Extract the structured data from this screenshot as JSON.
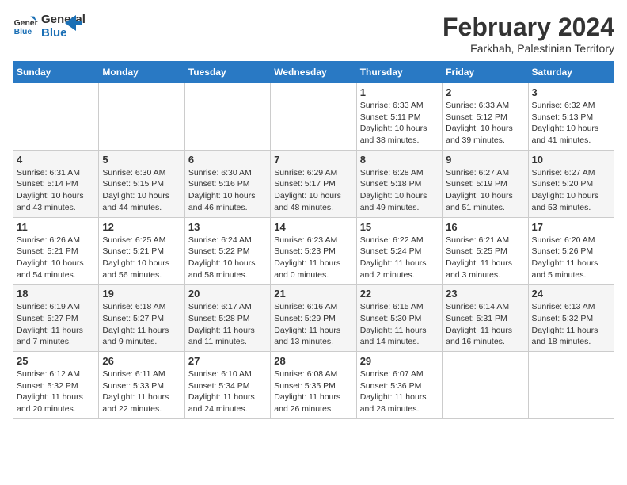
{
  "logo": {
    "line1": "General",
    "line2": "Blue"
  },
  "title": "February 2024",
  "location": "Farkhah, Palestinian Territory",
  "days_of_week": [
    "Sunday",
    "Monday",
    "Tuesday",
    "Wednesday",
    "Thursday",
    "Friday",
    "Saturday"
  ],
  "weeks": [
    [
      {
        "day": "",
        "info": ""
      },
      {
        "day": "",
        "info": ""
      },
      {
        "day": "",
        "info": ""
      },
      {
        "day": "",
        "info": ""
      },
      {
        "day": "1",
        "info": "Sunrise: 6:33 AM\nSunset: 5:11 PM\nDaylight: 10 hours\nand 38 minutes."
      },
      {
        "day": "2",
        "info": "Sunrise: 6:33 AM\nSunset: 5:12 PM\nDaylight: 10 hours\nand 39 minutes."
      },
      {
        "day": "3",
        "info": "Sunrise: 6:32 AM\nSunset: 5:13 PM\nDaylight: 10 hours\nand 41 minutes."
      }
    ],
    [
      {
        "day": "4",
        "info": "Sunrise: 6:31 AM\nSunset: 5:14 PM\nDaylight: 10 hours\nand 43 minutes."
      },
      {
        "day": "5",
        "info": "Sunrise: 6:30 AM\nSunset: 5:15 PM\nDaylight: 10 hours\nand 44 minutes."
      },
      {
        "day": "6",
        "info": "Sunrise: 6:30 AM\nSunset: 5:16 PM\nDaylight: 10 hours\nand 46 minutes."
      },
      {
        "day": "7",
        "info": "Sunrise: 6:29 AM\nSunset: 5:17 PM\nDaylight: 10 hours\nand 48 minutes."
      },
      {
        "day": "8",
        "info": "Sunrise: 6:28 AM\nSunset: 5:18 PM\nDaylight: 10 hours\nand 49 minutes."
      },
      {
        "day": "9",
        "info": "Sunrise: 6:27 AM\nSunset: 5:19 PM\nDaylight: 10 hours\nand 51 minutes."
      },
      {
        "day": "10",
        "info": "Sunrise: 6:27 AM\nSunset: 5:20 PM\nDaylight: 10 hours\nand 53 minutes."
      }
    ],
    [
      {
        "day": "11",
        "info": "Sunrise: 6:26 AM\nSunset: 5:21 PM\nDaylight: 10 hours\nand 54 minutes."
      },
      {
        "day": "12",
        "info": "Sunrise: 6:25 AM\nSunset: 5:21 PM\nDaylight: 10 hours\nand 56 minutes."
      },
      {
        "day": "13",
        "info": "Sunrise: 6:24 AM\nSunset: 5:22 PM\nDaylight: 10 hours\nand 58 minutes."
      },
      {
        "day": "14",
        "info": "Sunrise: 6:23 AM\nSunset: 5:23 PM\nDaylight: 11 hours\nand 0 minutes."
      },
      {
        "day": "15",
        "info": "Sunrise: 6:22 AM\nSunset: 5:24 PM\nDaylight: 11 hours\nand 2 minutes."
      },
      {
        "day": "16",
        "info": "Sunrise: 6:21 AM\nSunset: 5:25 PM\nDaylight: 11 hours\nand 3 minutes."
      },
      {
        "day": "17",
        "info": "Sunrise: 6:20 AM\nSunset: 5:26 PM\nDaylight: 11 hours\nand 5 minutes."
      }
    ],
    [
      {
        "day": "18",
        "info": "Sunrise: 6:19 AM\nSunset: 5:27 PM\nDaylight: 11 hours\nand 7 minutes."
      },
      {
        "day": "19",
        "info": "Sunrise: 6:18 AM\nSunset: 5:27 PM\nDaylight: 11 hours\nand 9 minutes."
      },
      {
        "day": "20",
        "info": "Sunrise: 6:17 AM\nSunset: 5:28 PM\nDaylight: 11 hours\nand 11 minutes."
      },
      {
        "day": "21",
        "info": "Sunrise: 6:16 AM\nSunset: 5:29 PM\nDaylight: 11 hours\nand 13 minutes."
      },
      {
        "day": "22",
        "info": "Sunrise: 6:15 AM\nSunset: 5:30 PM\nDaylight: 11 hours\nand 14 minutes."
      },
      {
        "day": "23",
        "info": "Sunrise: 6:14 AM\nSunset: 5:31 PM\nDaylight: 11 hours\nand 16 minutes."
      },
      {
        "day": "24",
        "info": "Sunrise: 6:13 AM\nSunset: 5:32 PM\nDaylight: 11 hours\nand 18 minutes."
      }
    ],
    [
      {
        "day": "25",
        "info": "Sunrise: 6:12 AM\nSunset: 5:32 PM\nDaylight: 11 hours\nand 20 minutes."
      },
      {
        "day": "26",
        "info": "Sunrise: 6:11 AM\nSunset: 5:33 PM\nDaylight: 11 hours\nand 22 minutes."
      },
      {
        "day": "27",
        "info": "Sunrise: 6:10 AM\nSunset: 5:34 PM\nDaylight: 11 hours\nand 24 minutes."
      },
      {
        "day": "28",
        "info": "Sunrise: 6:08 AM\nSunset: 5:35 PM\nDaylight: 11 hours\nand 26 minutes."
      },
      {
        "day": "29",
        "info": "Sunrise: 6:07 AM\nSunset: 5:36 PM\nDaylight: 11 hours\nand 28 minutes."
      },
      {
        "day": "",
        "info": ""
      },
      {
        "day": "",
        "info": ""
      }
    ]
  ]
}
